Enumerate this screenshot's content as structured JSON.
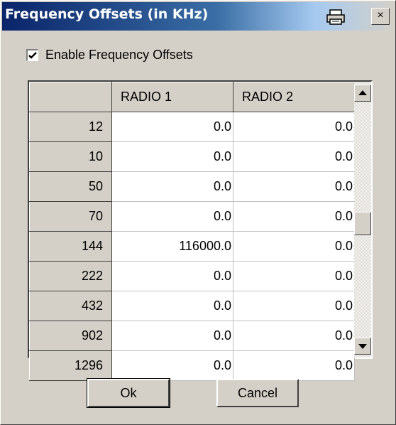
{
  "window": {
    "title": "Frequency Offsets (in KHz)",
    "close_glyph": "×"
  },
  "icons": {
    "title_icon": "printer-icon",
    "close": "close-icon",
    "scroll_up": "arrow-up-icon",
    "scroll_down": "arrow-down-icon",
    "check": "checkmark-icon"
  },
  "enable_offsets": {
    "checked": true,
    "label": "Enable Frequency Offsets"
  },
  "grid": {
    "corner": "",
    "columns": [
      "RADIO 1",
      "RADIO 2"
    ],
    "rows": [
      {
        "band": "12",
        "radio1": "0.0",
        "radio2": "0.0"
      },
      {
        "band": "10",
        "radio1": "0.0",
        "radio2": "0.0"
      },
      {
        "band": "50",
        "radio1": "0.0",
        "radio2": "0.0"
      },
      {
        "band": "70",
        "radio1": "0.0",
        "radio2": "0.0"
      },
      {
        "band": "144",
        "radio1": "116000.0",
        "radio2": "0.0"
      },
      {
        "band": "222",
        "radio1": "0.0",
        "radio2": "0.0"
      },
      {
        "band": "432",
        "radio1": "0.0",
        "radio2": "0.0"
      },
      {
        "band": "902",
        "radio1": "0.0",
        "radio2": "0.0"
      },
      {
        "band": "1296",
        "radio1": "0.0",
        "radio2": "0.0"
      }
    ],
    "scroll_position": 0.52,
    "visible_fraction": 0.1
  },
  "buttons": {
    "ok": "Ok",
    "cancel": "Cancel"
  }
}
